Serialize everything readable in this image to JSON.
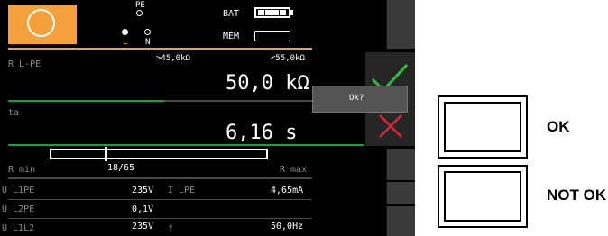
{
  "header": {
    "pe_label": "PE",
    "l_label": "L",
    "n_label": "N",
    "bat_label": "BAT",
    "mem_label": "MEM",
    "battery_level_cells": 4
  },
  "limits": {
    "param_label": "R L-PE",
    "lower": ">45,0kΩ",
    "upper": "<55,0kΩ"
  },
  "main_value": "50,0 kΩ",
  "ta": {
    "label": "ta",
    "value": "6,16  s"
  },
  "range": {
    "left_label": "R min",
    "count": "18/65",
    "right_label": "R max"
  },
  "readings": [
    {
      "left_label": "U L1PE",
      "left_value": "235V",
      "right_label": "I LPE",
      "right_value": "4,65mA"
    },
    {
      "left_label": "U L2PE",
      "left_value": "0,1V",
      "right_label": "",
      "right_value": ""
    },
    {
      "left_label": "U L1L2",
      "left_value": "235V",
      "right_label": "f",
      "right_value": "50,0Hz"
    }
  ],
  "popup": {
    "text": "Ok?"
  },
  "side_buttons": {
    "ok_label": "OK",
    "not_ok_label": "NOT OK"
  },
  "colors": {
    "accent_orange": "#f4a13d",
    "ok_green": "#2fbf3a",
    "not_ok_red": "#d9263b",
    "separator_green": "#17a335"
  }
}
